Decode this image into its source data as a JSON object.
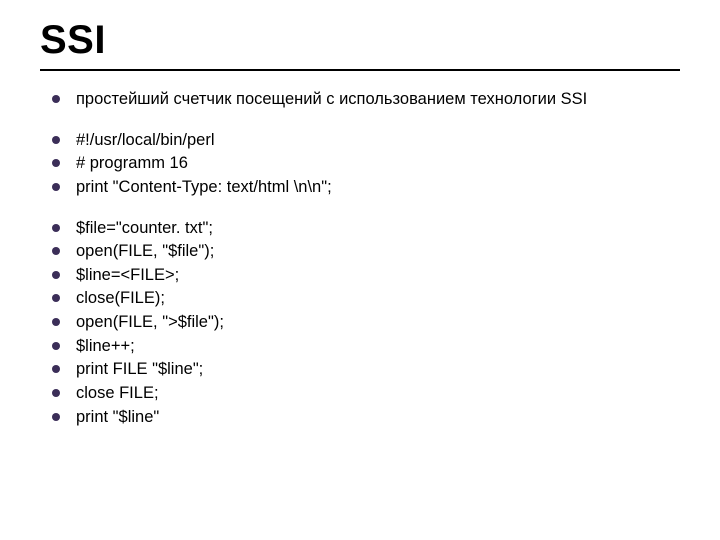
{
  "title": "SSI",
  "group1": [
    "простейший счетчик посещений с использованием технологии SSI"
  ],
  "group2": [
    "#!/usr/local/bin/perl",
    "# programm 16",
    "print \"Content-Type: text/html \\n\\n\";"
  ],
  "group3": [
    "$file=\"counter. txt\";",
    "open(FILE, \"$file\");",
    "$line=<FILE>;",
    "close(FILE);",
    "open(FILE, \">$file\");",
    "$line++;",
    "print FILE \"$line\";",
    "close FILE;",
    "print \"$line\""
  ]
}
